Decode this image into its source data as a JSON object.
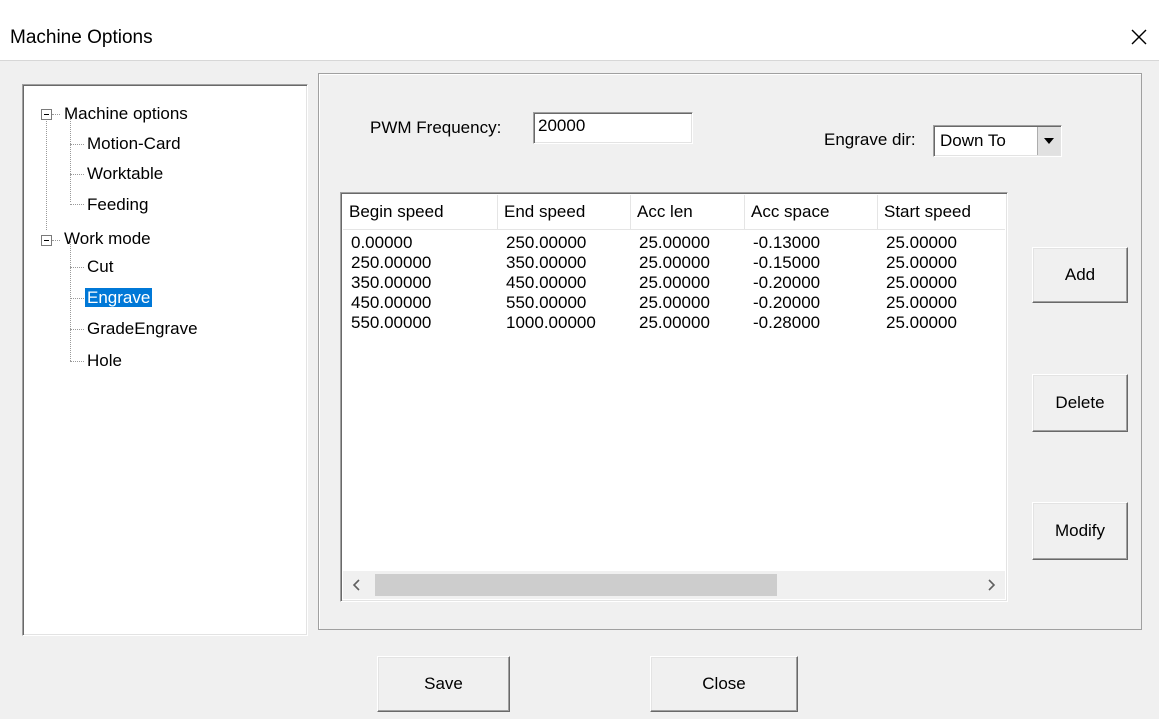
{
  "window": {
    "title": "Machine Options",
    "close_glyph": "✕"
  },
  "tree": {
    "items": [
      {
        "label": "Machine options",
        "level": 0,
        "expanded": true
      },
      {
        "label": "Motion-Card",
        "level": 1
      },
      {
        "label": "Worktable",
        "level": 1
      },
      {
        "label": "Feeding",
        "level": 1
      },
      {
        "label": "Work mode",
        "level": 0,
        "expanded": true
      },
      {
        "label": "Cut",
        "level": 1
      },
      {
        "label": "Engrave",
        "level": 1,
        "selected": true
      },
      {
        "label": "GradeEngrave",
        "level": 1
      },
      {
        "label": "Hole",
        "level": 1
      }
    ]
  },
  "engrave": {
    "pwm_label": "PWM Frequency:",
    "pwm_value": "20000",
    "dir_label": "Engrave dir:",
    "dir_value": "Down To"
  },
  "table": {
    "columns": [
      "Begin speed",
      "End speed",
      "Acc len",
      "Acc space",
      "Start speed"
    ],
    "rows": [
      [
        "0.00000",
        "250.00000",
        "25.00000",
        "-0.13000",
        "25.00000"
      ],
      [
        "250.00000",
        "350.00000",
        "25.00000",
        "-0.15000",
        "25.00000"
      ],
      [
        "350.00000",
        "450.00000",
        "25.00000",
        "-0.20000",
        "25.00000"
      ],
      [
        "450.00000",
        "550.00000",
        "25.00000",
        "-0.20000",
        "25.00000"
      ],
      [
        "550.00000",
        "1000.00000",
        "25.00000",
        "-0.28000",
        "25.00000"
      ]
    ]
  },
  "buttons": {
    "add": "Add",
    "delete": "Delete",
    "modify": "Modify",
    "save": "Save",
    "close": "Close"
  },
  "colors": {
    "selection": "#0078d7",
    "dialog_bg": "#f0f0f0"
  }
}
